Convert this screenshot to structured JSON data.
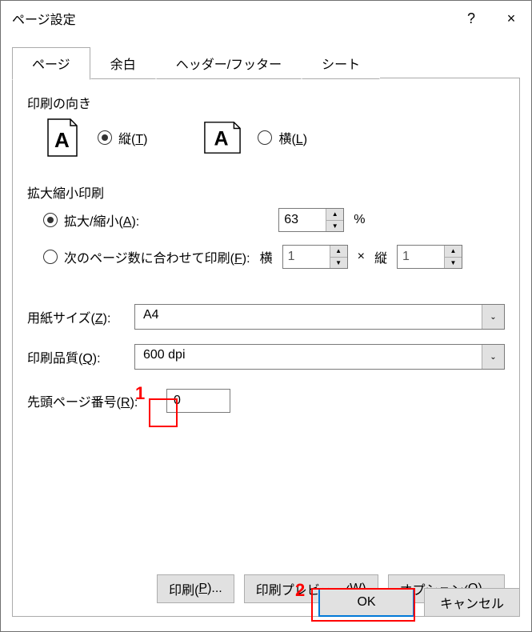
{
  "window": {
    "title": "ページ設定",
    "help": "?",
    "close": "×"
  },
  "tabs": {
    "page": "ページ",
    "margins": "余白",
    "header_footer": "ヘッダー/フッター",
    "sheet": "シート"
  },
  "orientation": {
    "group_label": "印刷の向き",
    "portrait": "縦(T)",
    "landscape": "横(L)"
  },
  "scaling": {
    "group_label": "拡大縮小印刷",
    "adjust": "拡大/縮小(A):",
    "adjust_value": "63",
    "percent": "%",
    "fit": "次のページ数に合わせて印刷(F):",
    "fit_wide_label": "横",
    "fit_wide_value": "1",
    "cross": "×",
    "fit_tall_label": "縦",
    "fit_tall_value": "1"
  },
  "paper": {
    "size_label": "用紙サイズ(Z):",
    "size_value": "A4",
    "quality_label": "印刷品質(Q):",
    "quality_value": "600 dpi",
    "first_page_label": "先頭ページ番号(R):",
    "first_page_value": "0"
  },
  "buttons": {
    "print": "印刷(P)...",
    "preview": "印刷プレビュー(W)",
    "options": "オプション(O)...",
    "ok": "OK",
    "cancel": "キャンセル"
  },
  "callouts": {
    "one": "1",
    "two": "2"
  }
}
